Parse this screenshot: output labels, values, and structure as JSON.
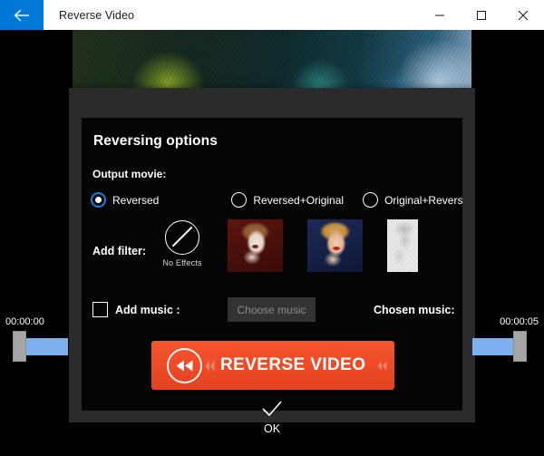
{
  "window": {
    "title": "Reverse Video",
    "back_icon": "back-arrow-icon",
    "accent_color": "#0078d7",
    "controls": {
      "minimize": "minimize-icon",
      "maximize": "maximize-icon",
      "close": "close-icon"
    }
  },
  "dialog": {
    "title": "Reversing options",
    "output_movie": {
      "label": "Output movie:",
      "options": [
        {
          "label": "Reversed",
          "selected": true
        },
        {
          "label": "Reversed+Original",
          "selected": false
        },
        {
          "label": "Original+Reversed",
          "selected": false
        }
      ]
    },
    "filter": {
      "label": "Add filter:",
      "no_effects_caption": "No Effects",
      "no_effects_icon": "no-effects-icon",
      "thumbnails": [
        {
          "name": "filter-thumbnail-negative"
        },
        {
          "name": "filter-thumbnail-original"
        },
        {
          "name": "filter-thumbnail-sketch"
        }
      ]
    },
    "music": {
      "checkbox_label": "Add music :",
      "checked": false,
      "choose_button": "Choose music",
      "choose_button_disabled": true,
      "chosen_label": "Chosen music:",
      "chosen_value": ""
    },
    "action": {
      "label": "REVERSE VIDEO",
      "icon": "rewind-icon",
      "color": "#ef4b28"
    }
  },
  "timeline": {
    "start_time": "00:00:00",
    "end_time": "00:00:05",
    "track_color": "#7eb0ee",
    "handle_color": "#a6a6a6"
  },
  "footer": {
    "ok_label": "OK",
    "ok_icon": "checkmark-icon"
  }
}
